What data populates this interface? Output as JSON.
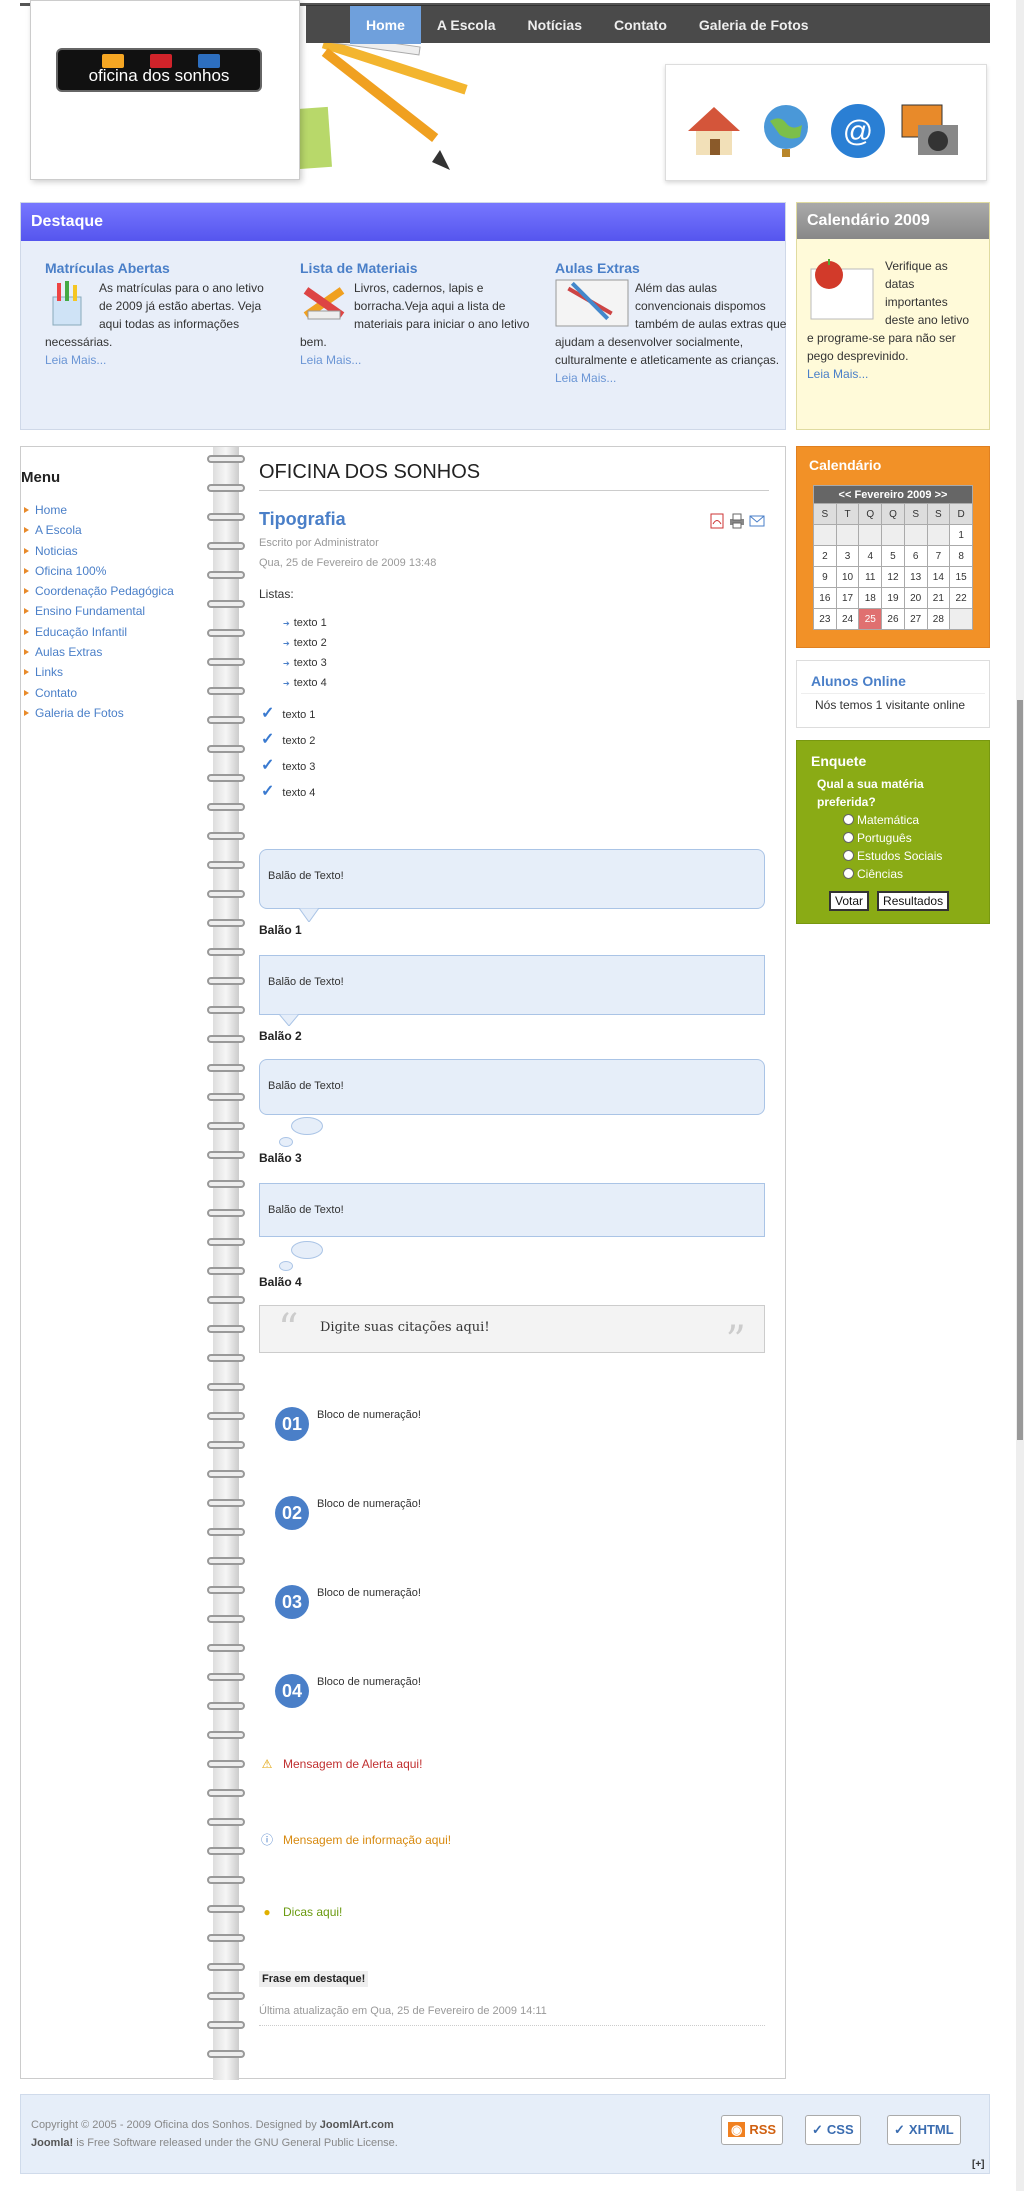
{
  "nav": {
    "items": [
      "Home",
      "A Escola",
      "Notícias",
      "Contato",
      "Galeria de Fotos"
    ],
    "active": 0
  },
  "logo": {
    "text": "oficina dos sonhos"
  },
  "destaque": {
    "title": "Destaque",
    "cols": [
      {
        "title": "Matrículas Abertas",
        "text": "As matrículas para o ano letivo de 2009 já estão abertas. Veja aqui todas as informações necessárias.",
        "more": "Leia Mais..."
      },
      {
        "title": "Lista de Materiais",
        "text": "Livros, cadernos, lapis e borracha.Veja aqui a lista de materiais para iniciar o ano letivo bem.",
        "more": "Leia Mais..."
      },
      {
        "title": "Aulas Extras",
        "text": "Além das aulas convencionais dispomos também de aulas extras que ajudam a desenvolver socialmente, culturalmente e atleticamente as crianças.",
        "more": "Leia Mais..."
      }
    ]
  },
  "cal09": {
    "title": "Calendário 2009",
    "text": "Verifique as datas importantes deste ano letivo e programe-se para não ser pego desprevinido.",
    "more": "Leia Mais..."
  },
  "menu": {
    "title": "Menu",
    "items": [
      "Home",
      "A Escola",
      "Noticias",
      "Oficina 100%",
      "Coordenação Pedagógica",
      "Ensino Fundamental",
      "Educação Infantil",
      "Aulas Extras",
      "Links",
      "Contato",
      "Galeria de Fotos"
    ]
  },
  "article": {
    "site_title": "OFICINA DOS SONHOS",
    "title": "Tipografia",
    "author": "Escrito por Administrator",
    "date": "Qua, 25 de Fevereiro de 2009 13:48",
    "listas_label": "Listas:",
    "bullets": [
      "texto 1",
      "texto 2",
      "texto 3",
      "texto 4"
    ],
    "checks": [
      "texto 1",
      "texto 2",
      "texto 3",
      "texto 4"
    ],
    "balloon_text": "Balão de Texto!",
    "balloon_labels": [
      "Balão 1",
      "Balão 2",
      "Balão 3",
      "Balão 4"
    ],
    "quote": "Digite suas citações aqui!",
    "numbers": [
      "01",
      "02",
      "03",
      "04"
    ],
    "number_text": "Bloco de numeração!",
    "alert": "Mensagem de Alerta aqui!",
    "info": "Mensagem de informação aqui!",
    "tip": "Dicas aqui!",
    "frase": "Frase em destaque!",
    "last_update": "Última atualização em Qua, 25 de Fevereiro de 2009 14:11"
  },
  "calendar": {
    "title": "Calendário",
    "month": "Fevereiro 2009",
    "prev": "<<",
    "next": ">>",
    "dow": [
      "S",
      "T",
      "Q",
      "Q",
      "S",
      "S",
      "D"
    ],
    "weeks": [
      [
        "",
        "",
        "",
        "",
        "",
        "",
        "1"
      ],
      [
        "2",
        "3",
        "4",
        "5",
        "6",
        "7",
        "8"
      ],
      [
        "9",
        "10",
        "11",
        "12",
        "13",
        "14",
        "15"
      ],
      [
        "16",
        "17",
        "18",
        "19",
        "20",
        "21",
        "22"
      ],
      [
        "23",
        "24",
        "25",
        "26",
        "27",
        "28",
        ""
      ]
    ],
    "today": "25"
  },
  "alunos": {
    "title": "Alunos Online",
    "text": "Nós temos 1 visitante online"
  },
  "enquete": {
    "title": "Enquete",
    "question": "Qual a sua matéria preferida?",
    "options": [
      "Matemática",
      "Português",
      "Estudos Sociais",
      "Ciências"
    ],
    "vote": "Votar",
    "results": "Resultados"
  },
  "footer": {
    "copyright": "Copyright © 2005 - 2009 Oficina dos Sonhos. Designed by",
    "designer": "JoomlArt.com",
    "joomla": "Joomla!",
    "license": "is Free Software released under the GNU General Public License.",
    "badges": [
      "RSS",
      "CSS",
      "XHTML"
    ],
    "plus": "[+]"
  },
  "colors": {
    "accent": "#4a7fc8",
    "destaque_header": "#6666f5",
    "calendar_bg": "#f29127",
    "enquete_bg": "#8aab15",
    "nav_active": "#6fa0dc"
  }
}
